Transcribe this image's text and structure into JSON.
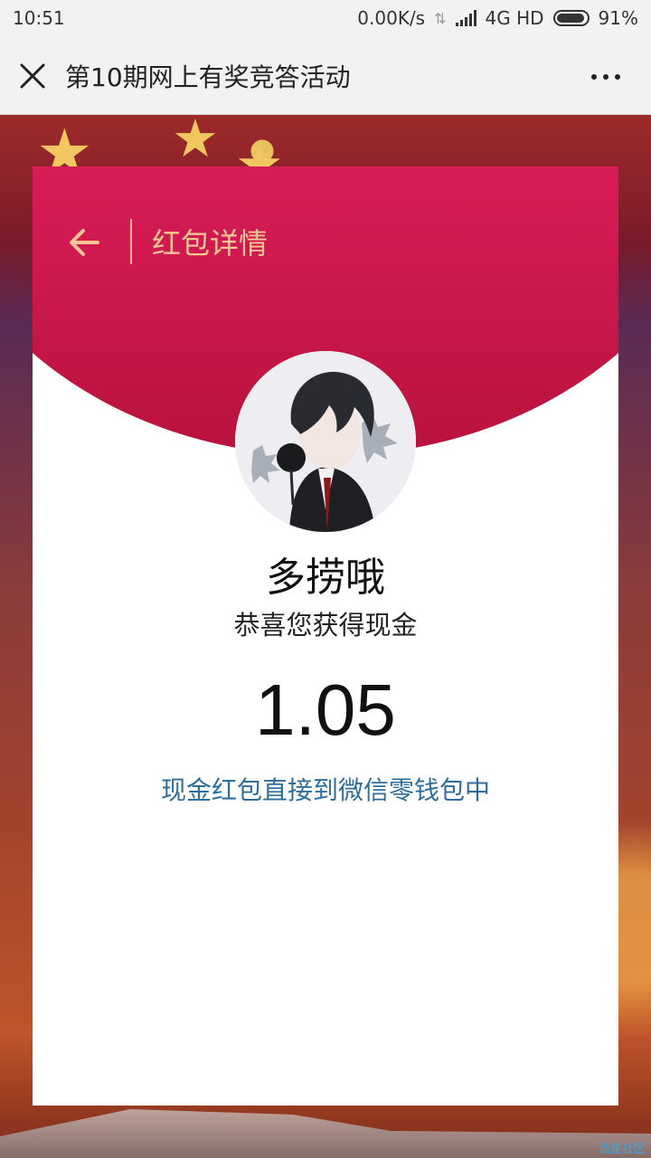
{
  "status_bar": {
    "time": "10:51",
    "network_speed": "0.00K/s",
    "network_type": "4G HD",
    "battery": "91%",
    "icons": [
      "data-transfer-icon",
      "signal-icon",
      "battery-icon"
    ]
  },
  "nav": {
    "title": "第10期网上有奖竞答活动",
    "close_icon": "close-icon",
    "more_icon": "more-icon"
  },
  "card": {
    "header_title": "红包详情",
    "back_icon": "back-arrow-icon",
    "user_name": "多捞哦",
    "congrats": "恭喜您获得现金",
    "amount": "1.05",
    "wallet_note": "现金红包直接到微信零钱包中"
  },
  "watermark": "流星社区",
  "colors": {
    "header_red": "#e21d5e",
    "header_text": "#f6c596",
    "link_blue": "#2e6d9c",
    "bar_gray": "#f2f2f2"
  }
}
